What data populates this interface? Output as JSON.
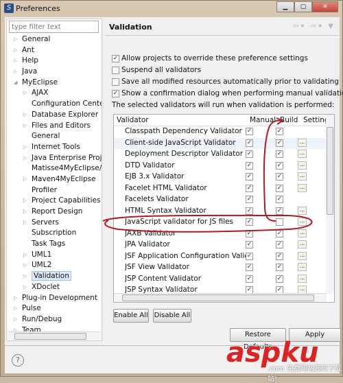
{
  "window": {
    "title": "Preferences",
    "buttons": [
      "minimize",
      "maximize",
      "close"
    ]
  },
  "left": {
    "filter_placeholder": "type filter text",
    "tree": [
      {
        "label": "General",
        "level": 0,
        "expandable": true
      },
      {
        "label": "Ant",
        "level": 0,
        "expandable": true
      },
      {
        "label": "Help",
        "level": 0,
        "expandable": true
      },
      {
        "label": "Java",
        "level": 0,
        "expandable": true
      },
      {
        "label": "MyEclipse",
        "level": 0,
        "expandable": true,
        "expanded": true
      },
      {
        "label": "AJAX",
        "level": 1,
        "expandable": true
      },
      {
        "label": "Configuration Center",
        "level": 1,
        "expandable": false
      },
      {
        "label": "Database Explorer",
        "level": 1,
        "expandable": true
      },
      {
        "label": "Files and Editors",
        "level": 1,
        "expandable": true
      },
      {
        "label": "General",
        "level": 1,
        "expandable": false
      },
      {
        "label": "Internet Tools",
        "level": 1,
        "expandable": true
      },
      {
        "label": "Java Enterprise Proje",
        "level": 1,
        "expandable": true
      },
      {
        "label": "Matisse4MyEclipse/S",
        "level": 1,
        "expandable": false
      },
      {
        "label": "Maven4MyEclipse",
        "level": 1,
        "expandable": true
      },
      {
        "label": "Profiler",
        "level": 1,
        "expandable": false
      },
      {
        "label": "Project Capabilities",
        "level": 1,
        "expandable": true
      },
      {
        "label": "Report Design",
        "level": 1,
        "expandable": true
      },
      {
        "label": "Servers",
        "level": 1,
        "expandable": true
      },
      {
        "label": "Subscription",
        "level": 1,
        "expandable": false
      },
      {
        "label": "Task Tags",
        "level": 1,
        "expandable": false
      },
      {
        "label": "UML1",
        "level": 1,
        "expandable": true
      },
      {
        "label": "UML2",
        "level": 1,
        "expandable": true
      },
      {
        "label": "Validation",
        "level": 1,
        "expandable": true,
        "selected": true
      },
      {
        "label": "XDoclet",
        "level": 1,
        "expandable": true
      },
      {
        "label": "Plug-in Development",
        "level": 0,
        "expandable": true
      },
      {
        "label": "Pulse",
        "level": 0,
        "expandable": true
      },
      {
        "label": "Run/Debug",
        "level": 0,
        "expandable": true
      },
      {
        "label": "Team",
        "level": 0,
        "expandable": true
      }
    ]
  },
  "page": {
    "title": "Validation",
    "options": [
      {
        "label": "Allow projects to override these preference settings",
        "checked": true
      },
      {
        "label": "Suspend all validators",
        "checked": false
      },
      {
        "label": "Save all modified resources automatically prior to validating",
        "checked": false
      },
      {
        "label": "Show a confirmation dialog when performing manual validations",
        "checked": true
      }
    ],
    "info": "The selected validators will run when validation is performed:",
    "columns": [
      "Validator",
      "Manual",
      "Build",
      "Setting"
    ],
    "validators": [
      {
        "name": "Classpath Dependency Validator",
        "manual": true,
        "build": true,
        "settings": false
      },
      {
        "name": "Client-side JavaScript Validator",
        "manual": true,
        "build": true,
        "settings": true
      },
      {
        "name": "Deployment Descriptor Validator",
        "manual": true,
        "build": true,
        "settings": true
      },
      {
        "name": "DTD Validator",
        "manual": true,
        "build": true,
        "settings": true
      },
      {
        "name": "EJB 3.x Validator",
        "manual": true,
        "build": true,
        "settings": true
      },
      {
        "name": "Facelet HTML Validator",
        "manual": true,
        "build": true,
        "settings": true
      },
      {
        "name": "Facelets Validator",
        "manual": true,
        "build": true,
        "settings": false
      },
      {
        "name": "HTML Syntax Validator",
        "manual": true,
        "build": true,
        "settings": true
      },
      {
        "name": "JavaScript validator for JS files",
        "manual": true,
        "build": false,
        "settings": true
      },
      {
        "name": "JAXB Validator",
        "manual": true,
        "build": true,
        "settings": true
      },
      {
        "name": "JPA Validator",
        "manual": true,
        "build": true,
        "settings": true
      },
      {
        "name": "JSF Application Configuration Valida...",
        "manual": true,
        "build": true,
        "settings": true
      },
      {
        "name": "JSF View Validator",
        "manual": true,
        "build": true,
        "settings": true
      },
      {
        "name": "JSP Content Validator",
        "manual": true,
        "build": true,
        "settings": true
      },
      {
        "name": "JSP Syntax Validator",
        "manual": true,
        "build": true,
        "settings": true
      }
    ],
    "settings_glyph": "...",
    "enable_all": "Enable All",
    "disable_all": "Disable All",
    "restore_defaults": "Restore Defaults",
    "apply": "Apply"
  },
  "help_glyph": "?",
  "watermark": {
    "text": "aspku",
    "sub": ".com 免费网站源码下载站!"
  },
  "annotation_color": "#b01822"
}
